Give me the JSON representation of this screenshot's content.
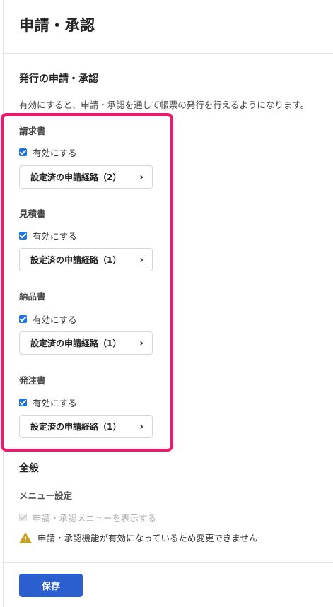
{
  "page": {
    "title": "申請・承認"
  },
  "issuance": {
    "section_title": "発行の申請・承認",
    "description": "有効にすると、申請・承認を通して帳票の発行を行えるようになります。",
    "documents": [
      {
        "label": "請求書",
        "checkbox_label": "有効にする",
        "checked": true,
        "route_button": "設定済の申請経路（2）"
      },
      {
        "label": "見積書",
        "checkbox_label": "有効にする",
        "checked": true,
        "route_button": "設定済の申請経路（1）"
      },
      {
        "label": "納品書",
        "checkbox_label": "有効にする",
        "checked": true,
        "route_button": "設定済の申請経路（1）"
      },
      {
        "label": "発注書",
        "checkbox_label": "有効にする",
        "checked": true,
        "route_button": "設定済の申請経路（1）"
      }
    ]
  },
  "general": {
    "section_title": "全般",
    "menu_settings_label": "メニュー設定",
    "show_menu_label": "申請・承認メニューを表示する",
    "warning": "申請・承認機能が有効になっているため変更できません"
  },
  "actions": {
    "save_label": "保存"
  },
  "colors": {
    "accent": "#1a73e8",
    "highlight": "#f0186c",
    "save": "#2b5fd0",
    "warning": "#c9a01c"
  },
  "icons": {
    "chevron": "chevron-right-icon",
    "warning": "warning-icon"
  }
}
